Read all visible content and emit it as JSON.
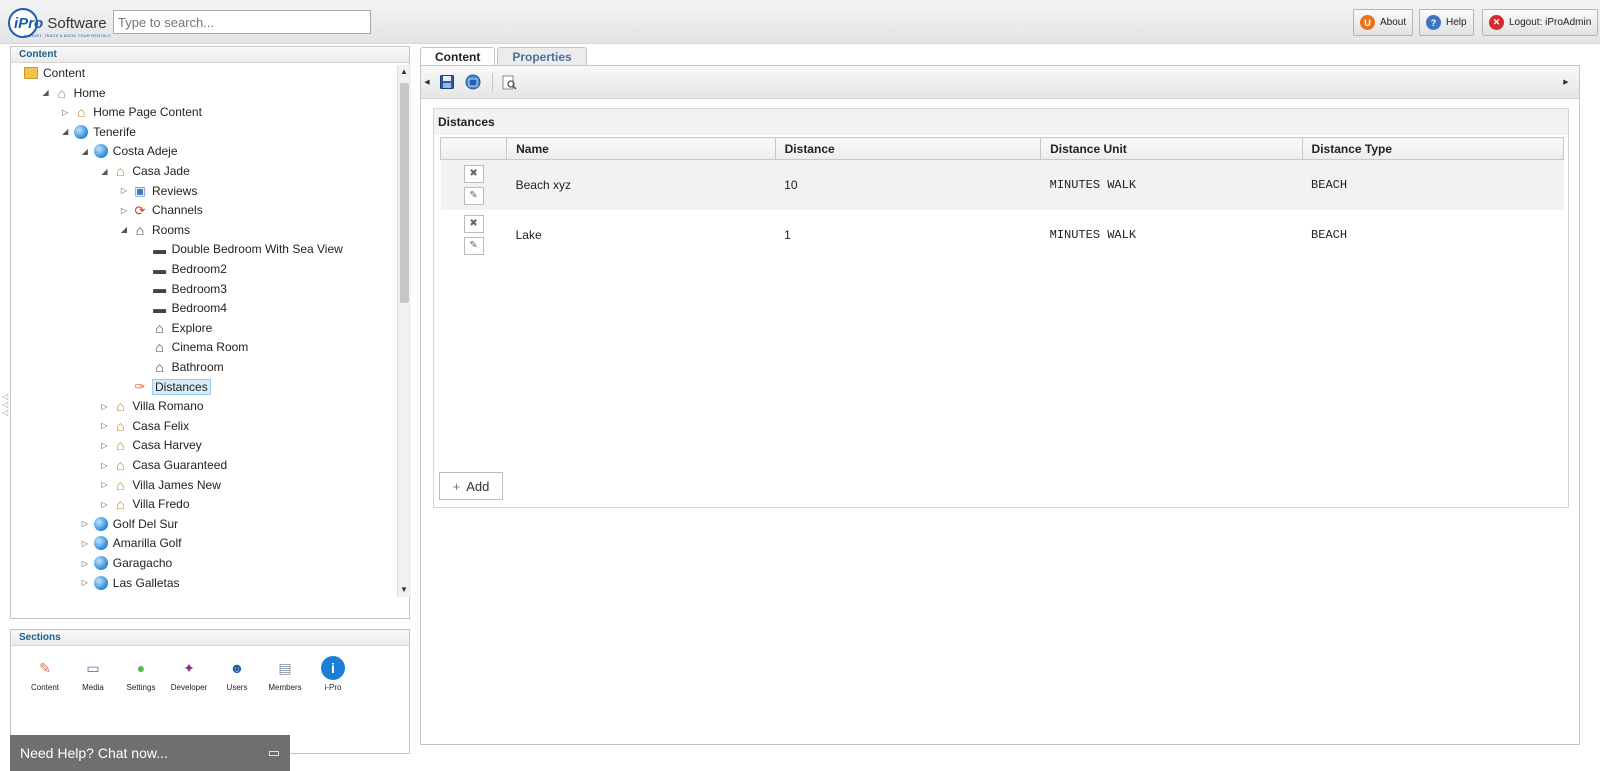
{
  "header": {
    "logo_brand": "iPro",
    "logo_word": "Software",
    "logo_tagline": "MARKET, TRACK & BOOK YOUR RENTALS",
    "search_placeholder": "Type to search...",
    "about_label": "About",
    "help_label": "Help",
    "logout_label": "Logout: iProAdmin"
  },
  "content_panel": {
    "title": "Content",
    "tree": [
      {
        "label": "Content",
        "icon": "folder-icon",
        "depth": 0,
        "toggle": ""
      },
      {
        "label": "Home",
        "icon": "home-icon",
        "depth": 1,
        "toggle": "◢"
      },
      {
        "label": "Home Page Content",
        "icon": "home-page-icon",
        "depth": 2,
        "toggle": "▷"
      },
      {
        "label": "Tenerife",
        "icon": "globe-icon",
        "depth": 2,
        "toggle": "◢"
      },
      {
        "label": "Costa Adeje",
        "icon": "globe-icon",
        "depth": 3,
        "toggle": "◢"
      },
      {
        "label": "Casa Jade",
        "icon": "property-icon",
        "depth": 4,
        "toggle": "◢"
      },
      {
        "label": "Reviews",
        "icon": "reviews-icon",
        "depth": 5,
        "toggle": "▷"
      },
      {
        "label": "Channels",
        "icon": "channels-icon",
        "depth": 5,
        "toggle": "▷"
      },
      {
        "label": "Rooms",
        "icon": "rooms-icon",
        "depth": 5,
        "toggle": "◢"
      },
      {
        "label": "Double Bedroom With Sea View",
        "icon": "bed-icon",
        "depth": 6,
        "toggle": ""
      },
      {
        "label": "Bedroom2",
        "icon": "bed-icon",
        "depth": 6,
        "toggle": ""
      },
      {
        "label": "Bedroom3",
        "icon": "bed-icon",
        "depth": 6,
        "toggle": ""
      },
      {
        "label": "Bedroom4",
        "icon": "bed-icon",
        "depth": 6,
        "toggle": ""
      },
      {
        "label": "Explore",
        "icon": "room-icon",
        "depth": 6,
        "toggle": ""
      },
      {
        "label": "Cinema Room",
        "icon": "room-icon",
        "depth": 6,
        "toggle": ""
      },
      {
        "label": "Bathroom",
        "icon": "room-icon",
        "depth": 6,
        "toggle": ""
      },
      {
        "label": "Distances",
        "icon": "distances-icon",
        "depth": 5,
        "toggle": "",
        "selected": true
      },
      {
        "label": "Villa Romano",
        "icon": "property-icon",
        "depth": 4,
        "toggle": "▷"
      },
      {
        "label": "Casa Felix",
        "icon": "property-icon",
        "depth": 4,
        "toggle": "▷"
      },
      {
        "label": "Casa Harvey",
        "icon": "property-icon",
        "depth": 4,
        "toggle": "▷"
      },
      {
        "label": "Casa Guaranteed",
        "icon": "property-icon",
        "depth": 4,
        "toggle": "▷"
      },
      {
        "label": "Villa James New",
        "icon": "property-icon",
        "depth": 4,
        "toggle": "▷"
      },
      {
        "label": "Villa Fredo",
        "icon": "property-icon",
        "depth": 4,
        "toggle": "▷"
      },
      {
        "label": "Golf Del Sur",
        "icon": "globe-icon",
        "depth": 3,
        "toggle": "▷"
      },
      {
        "label": "Amarilla Golf",
        "icon": "globe-icon",
        "depth": 3,
        "toggle": "▷"
      },
      {
        "label": "Garagacho",
        "icon": "globe-icon",
        "depth": 3,
        "toggle": "▷"
      },
      {
        "label": "Las Galletas",
        "icon": "globe-icon",
        "depth": 3,
        "toggle": "▷"
      }
    ]
  },
  "sections_panel": {
    "title": "Sections",
    "items": [
      {
        "label": "Content",
        "icon": "content-section-icon",
        "color": "#e8734a"
      },
      {
        "label": "Media",
        "icon": "media-section-icon",
        "color": "#4b74b8"
      },
      {
        "label": "Settings",
        "icon": "settings-section-icon",
        "color": "#64b35b"
      },
      {
        "label": "Developer",
        "icon": "developer-section-icon",
        "color": "#8a2b8d"
      },
      {
        "label": "Users",
        "icon": "users-section-icon",
        "color": "#1f5fa8"
      },
      {
        "label": "Members",
        "icon": "members-section-icon",
        "color": "#7c8ea3"
      },
      {
        "label": "i-Pro",
        "icon": "ipro-section-icon",
        "color": "#1c7fd6"
      }
    ]
  },
  "chat": {
    "label": "Need Help? Chat now..."
  },
  "tabs": [
    {
      "label": "Content",
      "active": true
    },
    {
      "label": "Properties",
      "active": false
    }
  ],
  "distances": {
    "title": "Distances",
    "columns": [
      "Name",
      "Distance",
      "Distance Unit",
      "Distance Type"
    ],
    "rows": [
      {
        "name": "Beach xyz",
        "distance": "10",
        "unit": "MINUTES WALK",
        "type": "BEACH"
      },
      {
        "name": "Lake",
        "distance": "1",
        "unit": "MINUTES WALK",
        "type": "BEACH"
      }
    ],
    "add_label": "Add"
  }
}
